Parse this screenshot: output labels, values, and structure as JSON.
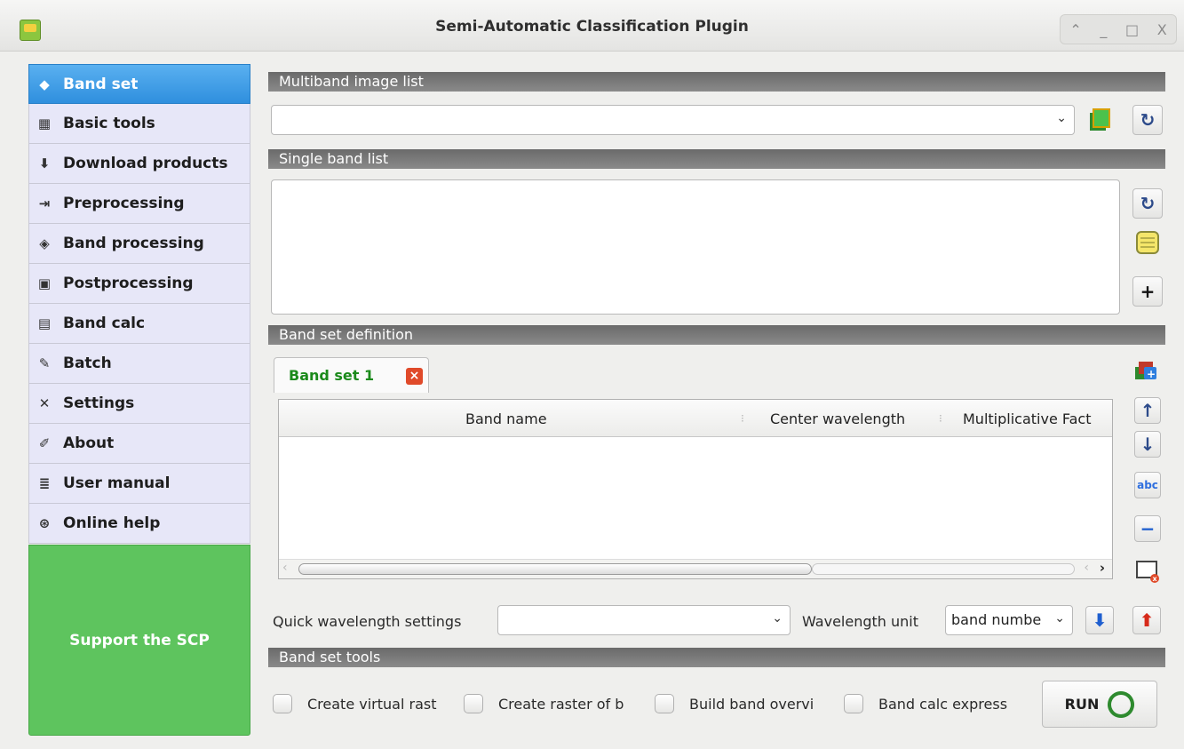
{
  "window": {
    "title": "Semi-Automatic Classification Plugin",
    "controls": [
      "⌃",
      "_",
      "□",
      "X"
    ]
  },
  "sidebar": {
    "items": [
      {
        "label": "Band set",
        "icon": "band-set-icon",
        "glyph": "◆",
        "active": true
      },
      {
        "label": "Basic tools",
        "icon": "basic-tools-icon",
        "glyph": "▦",
        "active": false
      },
      {
        "label": "Download products",
        "icon": "download-icon",
        "glyph": "⬇",
        "active": false
      },
      {
        "label": "Preprocessing",
        "icon": "preprocessing-icon",
        "glyph": "⇥",
        "active": false
      },
      {
        "label": "Band processing",
        "icon": "band-processing-icon",
        "glyph": "◈",
        "active": false
      },
      {
        "label": "Postprocessing",
        "icon": "postprocessing-icon",
        "glyph": "▣",
        "active": false
      },
      {
        "label": "Band calc",
        "icon": "calculator-icon",
        "glyph": "▤",
        "active": false
      },
      {
        "label": "Batch",
        "icon": "batch-icon",
        "glyph": "✎",
        "active": false
      },
      {
        "label": "Settings",
        "icon": "settings-icon",
        "glyph": "✕",
        "active": false
      },
      {
        "label": "About",
        "icon": "about-icon",
        "glyph": "✐",
        "active": false
      },
      {
        "label": "User manual",
        "icon": "manual-icon",
        "glyph": "≣",
        "active": false
      },
      {
        "label": "Online help",
        "icon": "help-icon",
        "glyph": "⊛",
        "active": false
      }
    ],
    "support_label": "Support the SCP"
  },
  "sections": {
    "multiband": "Multiband image list",
    "single": "Single band list",
    "definition": "Band set definition",
    "tools": "Band set tools"
  },
  "multiband_combo": {
    "value": ""
  },
  "bandset_tab": {
    "label": "Band set 1",
    "close_glyph": "×"
  },
  "table": {
    "columns": [
      "Band name",
      "Center wavelength",
      "Multiplicative Fact"
    ],
    "rows": []
  },
  "quick_wavelength": {
    "label": "Quick wavelength settings",
    "value": ""
  },
  "wavelength_unit": {
    "label": "Wavelength unit",
    "value": "band numbe"
  },
  "tools": {
    "checkboxes": [
      "Create virtual rast",
      "Create raster of b",
      "Build band overvi",
      "Band calc express"
    ],
    "run_label": "RUN"
  },
  "colors": {
    "active_tab": "#3a9be6",
    "support_bg": "#5ec45e",
    "tab_label": "#1b8a1b",
    "section_header": "#777777"
  }
}
